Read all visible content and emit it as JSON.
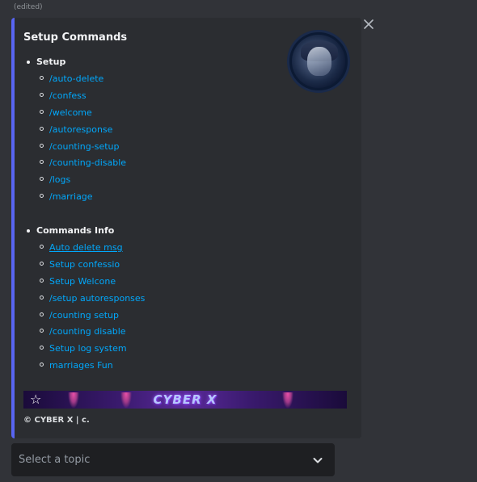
{
  "message": {
    "edited_label": "(edited)"
  },
  "embed": {
    "title": "Setup Commands",
    "accent_color": "#5865f2",
    "thumbnail_icon": "anime-avatar-image",
    "sections": [
      {
        "heading": "Setup",
        "items": [
          "/auto-delete",
          "/confess",
          "/welcome",
          "/autoresponse",
          "/counting-setup",
          "/counting-disable",
          "/logs",
          "/marriage"
        ]
      },
      {
        "heading": "Commands Info",
        "items": [
          "Auto delete msg",
          "Setup confessio",
          "Setup Welcone",
          "/setup autoresponses",
          "/counting setup",
          "/counting disable",
          "Setup log system",
          "marriages Fun"
        ]
      }
    ],
    "banner_text": "CYBER X",
    "footer": "© CYBER X | c."
  },
  "controls": {
    "close_icon": "close-icon",
    "select": {
      "placeholder": "Select a topic",
      "icon": "chevron-down-icon"
    }
  },
  "colors": {
    "background": "#313338",
    "embed_bg": "#2b2d31",
    "link": "#00a8fc",
    "select_bg": "#1e1f22"
  }
}
